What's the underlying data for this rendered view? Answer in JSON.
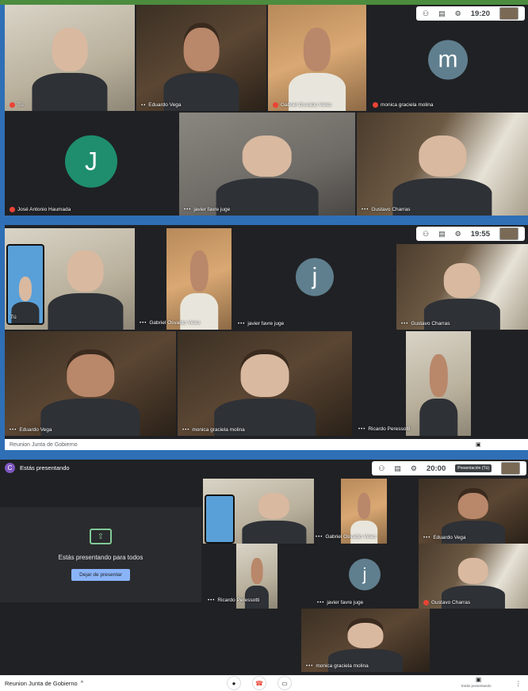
{
  "panel1": {
    "clock": "19:20",
    "tiles": [
      {
        "name": "Tú",
        "muted": true
      },
      {
        "name": "Eduardo Vega",
        "muted": false
      },
      {
        "name": "Gabriel Osvaldo Velez",
        "muted": true
      },
      {
        "name": "monica graciela molina",
        "muted": true,
        "avatar_letter": "m",
        "avatar_color": "#5f7f8e"
      },
      {
        "name": "José Antonio Haumada",
        "muted": true,
        "avatar_letter": "J",
        "avatar_color": "#1e8e6e"
      },
      {
        "name": "javier favre juge",
        "muted": false
      },
      {
        "name": "Gustavo Charras",
        "muted": false
      }
    ]
  },
  "panel2": {
    "clock": "19:55",
    "self_label": "Tú",
    "tiles": [
      {
        "name": ""
      },
      {
        "name": "Gabriel Osvaldo Velez"
      },
      {
        "name": "javier favre juge",
        "avatar_letter": "j",
        "avatar_color": "#5f7f8e"
      },
      {
        "name": "Gustavo Charras"
      },
      {
        "name": "Eduardo Vega"
      },
      {
        "name": "monica graciela molina"
      },
      {
        "name": "Ricardo Peressotti"
      }
    ],
    "footer": "Reunion Junta de Gobierno"
  },
  "panel3": {
    "banner_letter": "C",
    "banner_text": "Estás presentando",
    "clock": "20:00",
    "present_text": "Estás presentando para todos",
    "stop_button": "Dejar de presentar",
    "preview_label": "Presentación (Tú)",
    "tiles": [
      {
        "name": ""
      },
      {
        "name": "Gabriel Osvaldo Velez"
      },
      {
        "name": "Eduardo Vega"
      },
      {
        "name": "Ricardo Peressotti"
      },
      {
        "name": "javier favre juge",
        "avatar_letter": "j",
        "avatar_color": "#5f7f8e"
      },
      {
        "name": "Gustavo Charras",
        "muted": true
      },
      {
        "name": "monica graciela molina"
      }
    ],
    "footer": "Reunion Junta de Gobierno",
    "footer_right": "Estás presentando"
  },
  "icons": {
    "people": "👥",
    "chat": "▤",
    "activities": "⚙",
    "mic": "🎤",
    "hangup": "☎",
    "camera": "▭",
    "present": "▣",
    "more": "⋮",
    "chevron": "^"
  },
  "colors": {
    "background": "#2f6fb6",
    "tile_bg": "#202124",
    "muted": "#ea4335",
    "present_btn": "#8ab4f8"
  }
}
